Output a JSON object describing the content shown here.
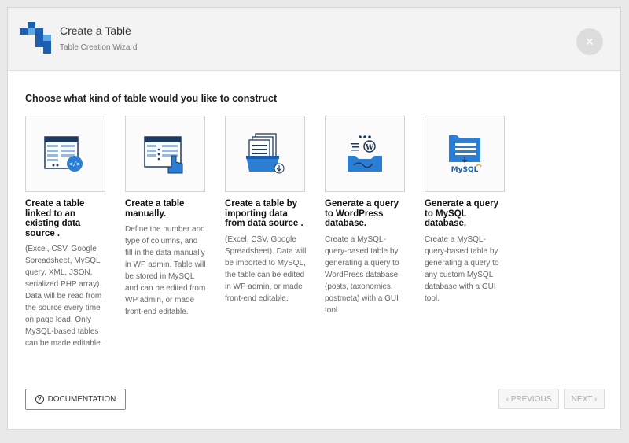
{
  "header": {
    "title": "Create a Table",
    "subtitle": "Table Creation Wizard",
    "close_label": "×"
  },
  "heading": "Choose what kind of table would you like to construct",
  "cards": [
    {
      "title": "Create a table linked to an existing data source .",
      "description": "(Excel, CSV, Google Spreadsheet, MySQL query, XML, JSON, serialized PHP array). Data will be read from the source every time on page load. Only MySQL-based tables can be made editable.",
      "icon": "linked-table-code-icon"
    },
    {
      "title": "Create a table manually.",
      "description": "Define the number and type of columns, and fill in the data manually in WP admin. Table will be stored in MySQL and can be edited from WP admin, or made front-end editable.",
      "icon": "manual-table-hand-icon"
    },
    {
      "title": "Create a table by importing data from data source .",
      "description": "(Excel, CSV, Google Spreadsheet). Data will be imported to MySQL, the table can be edited in WP admin, or made front-end editable.",
      "icon": "import-files-folder-icon"
    },
    {
      "title": "Generate a query to WordPress database.",
      "description": "Create a MySQL-query-based table by generating a query to WordPress database (posts, taxonomies, postmeta) with a GUI tool.",
      "icon": "wordpress-query-icon"
    },
    {
      "title": "Generate a query to MySQL database.",
      "description": "Create a MySQL-query-based table by generating a query to any custom MySQL database with a GUI tool.",
      "icon": "mysql-query-icon"
    }
  ],
  "footer": {
    "documentation_label": "DOCUMENTATION",
    "documentation_icon": "?",
    "previous_label": "‹ PREVIOUS",
    "next_label": "NEXT ›"
  },
  "icon_text": {
    "code_tag": "</>",
    "mysql": "MySQL"
  },
  "colors": {
    "accent_blue": "#2a7fd4",
    "dark_navy": "#1f3a5f",
    "mysql_orange": "#f5a623"
  }
}
